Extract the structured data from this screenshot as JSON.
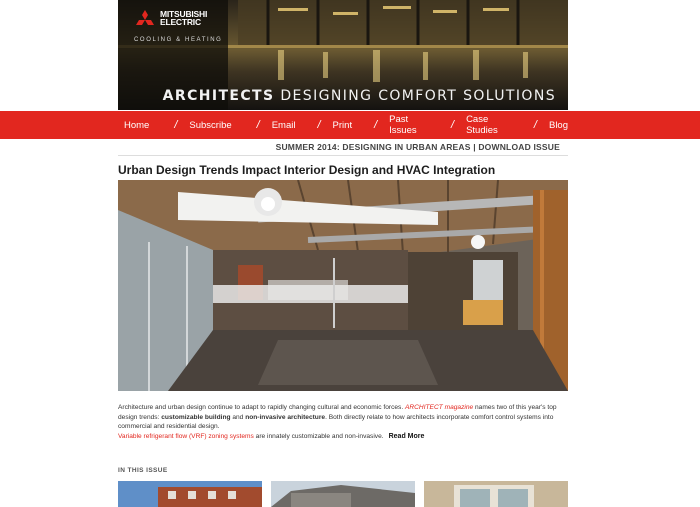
{
  "brand": {
    "name_line1": "MITSUBISHI",
    "name_line2": "ELECTRIC",
    "subline": "COOLING & HEATING",
    "tagline_bold": "ARCHITECTS",
    "tagline_rest": " DESIGNING COMFORT SOLUTIONS",
    "accent_color": "#e2271f"
  },
  "nav": {
    "items": [
      {
        "label": "Home"
      },
      {
        "label": "Subscribe"
      },
      {
        "label": "Email"
      },
      {
        "label": "Print"
      },
      {
        "label": "Past Issues"
      },
      {
        "label": "Case Studies"
      },
      {
        "label": "Blog"
      }
    ],
    "separator": "/"
  },
  "issue": {
    "line": "SUMMER 2014: DESIGNING IN URBAN AREAS | DOWNLOAD ISSUE"
  },
  "article": {
    "title": "Urban Design Trends Impact Interior Design and HVAC Integration",
    "p1_a": "Architecture and urban design continue to adapt to rapidly changing cultural and economic forces. ",
    "p1_link": "ARCHITECT magazine",
    "p1_b": " names two of this year's top design trends: ",
    "p1_bold1": "customizable building",
    "p1_c": " and ",
    "p1_bold2": "non-invasive architecture",
    "p1_d": ". Both directly relate to how architects incorporate comfort control systems into commercial and residential design.",
    "vrf_link": "Variable refrigerant flow (VRF) zoning systems",
    "vrf_rest": " are innately customizable and non-invasive.",
    "read_more": "Read More"
  },
  "in_this_issue": {
    "heading": "IN THIS ISSUE"
  }
}
